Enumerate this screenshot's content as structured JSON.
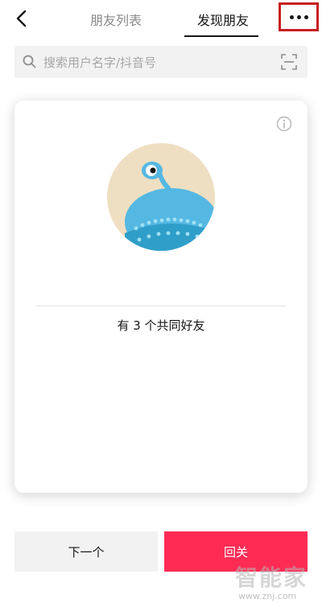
{
  "header": {
    "tabs": [
      {
        "label": "朋友列表",
        "active": false
      },
      {
        "label": "发现朋友",
        "active": true
      }
    ],
    "more_icon": "more-horizontal-icon",
    "back_icon": "chevron-left-icon"
  },
  "search": {
    "placeholder": "搜索用户名字/抖音号",
    "icon": "search-icon",
    "scan_icon": "scan-icon"
  },
  "card": {
    "info_icon": "info-icon",
    "mutual_friends_text": "有 3 个共同好友"
  },
  "actions": {
    "next_label": "下一个",
    "follow_label": "回关"
  },
  "watermark": {
    "brand": "智能家",
    "url": "www.znj.com"
  },
  "colors": {
    "follow_button": "#fe2c55",
    "highlight_border": "#c81e1e",
    "avatar_bg": "#efdfc2",
    "avatar_creature": "#55b8e3"
  }
}
